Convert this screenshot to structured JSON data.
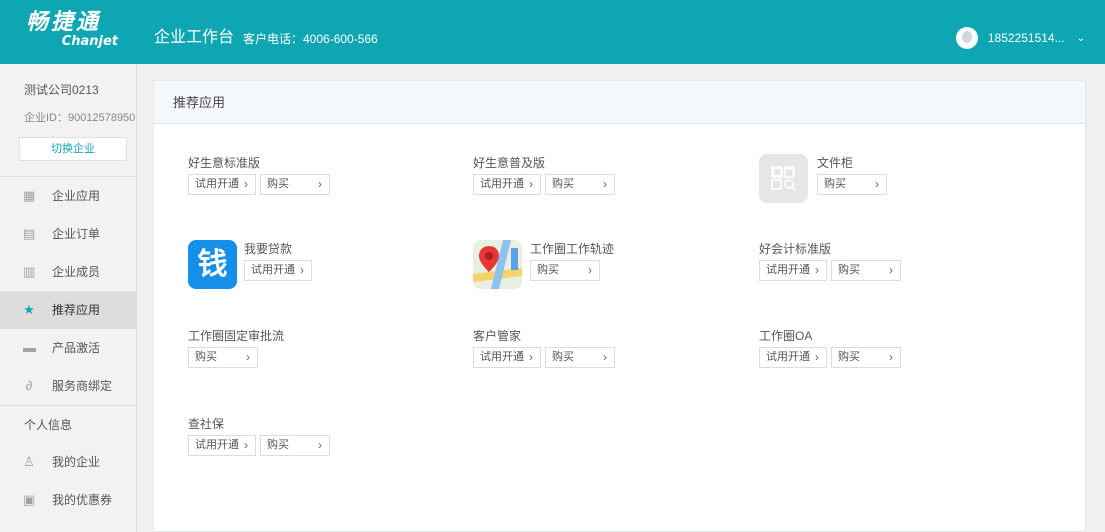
{
  "header": {
    "logo_cn": "畅捷通",
    "logo_en": "Chanjet",
    "title": "企业工作台",
    "phone": "客户电话：4006-600-566",
    "user": "1852251514..."
  },
  "sidebar": {
    "company_name": "测试公司0213",
    "company_id": "企业ID：90012578950",
    "switch_label": "切换企业",
    "items": [
      {
        "label": "企业应用"
      },
      {
        "label": "企业订单"
      },
      {
        "label": "企业成员"
      },
      {
        "label": "推荐应用"
      },
      {
        "label": "产品激活"
      },
      {
        "label": "服务商绑定"
      }
    ],
    "section_personal": "个人信息",
    "personal_items": [
      {
        "label": "我的企业"
      },
      {
        "label": "我的优惠券"
      }
    ]
  },
  "main": {
    "panel_title": "推荐应用",
    "trial_label": "试用开通",
    "buy_label": "购买",
    "apps": [
      {
        "name": "好生意标准版"
      },
      {
        "name": "好生意普及版"
      },
      {
        "name": "文件柜"
      },
      {
        "name": "我要贷款",
        "icon_text": "钱"
      },
      {
        "name": "工作圈工作轨迹"
      },
      {
        "name": "好会计标准版"
      },
      {
        "name": "工作圈固定审批流"
      },
      {
        "name": "客户管家"
      },
      {
        "name": "工作圈OA"
      },
      {
        "name": "查社保"
      }
    ]
  }
}
